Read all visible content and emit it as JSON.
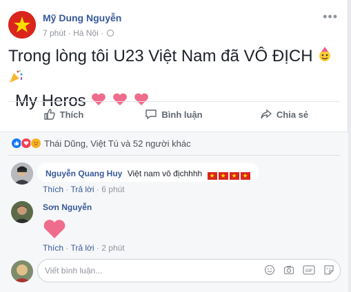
{
  "post": {
    "author": "Mỹ Dung Nguyễn",
    "time": "7 phút",
    "location": "Hà Nội",
    "text_line1": "Trong lòng tôi U23 Việt Nam đã VÔ ĐỊCH",
    "text_line2": "My Heros"
  },
  "actions": {
    "like": "Thích",
    "comment": "Bình luận",
    "share": "Chia sẻ"
  },
  "reactions": {
    "summary": "Thái Dũng, Việt Tú và 52 người khác",
    "icons": [
      "like-icon",
      "love-icon",
      "sad-icon"
    ]
  },
  "comments": [
    {
      "author": "Nguyễn Quang Huy",
      "text": "Việt nam vô địchhhh",
      "like": "Thích",
      "reply": "Trả lời",
      "time": "6 phút"
    },
    {
      "author": "Sơn Nguyễn",
      "like": "Thích",
      "reply": "Trả lời",
      "time": "2 phút"
    }
  ],
  "composer": {
    "placeholder": "Viết bình luận..."
  },
  "colors": {
    "link": "#365899",
    "like_blue": "#1877f2",
    "love_red": "#f33e58",
    "flag_red": "#da251d",
    "flag_star": "#ffdd00"
  }
}
